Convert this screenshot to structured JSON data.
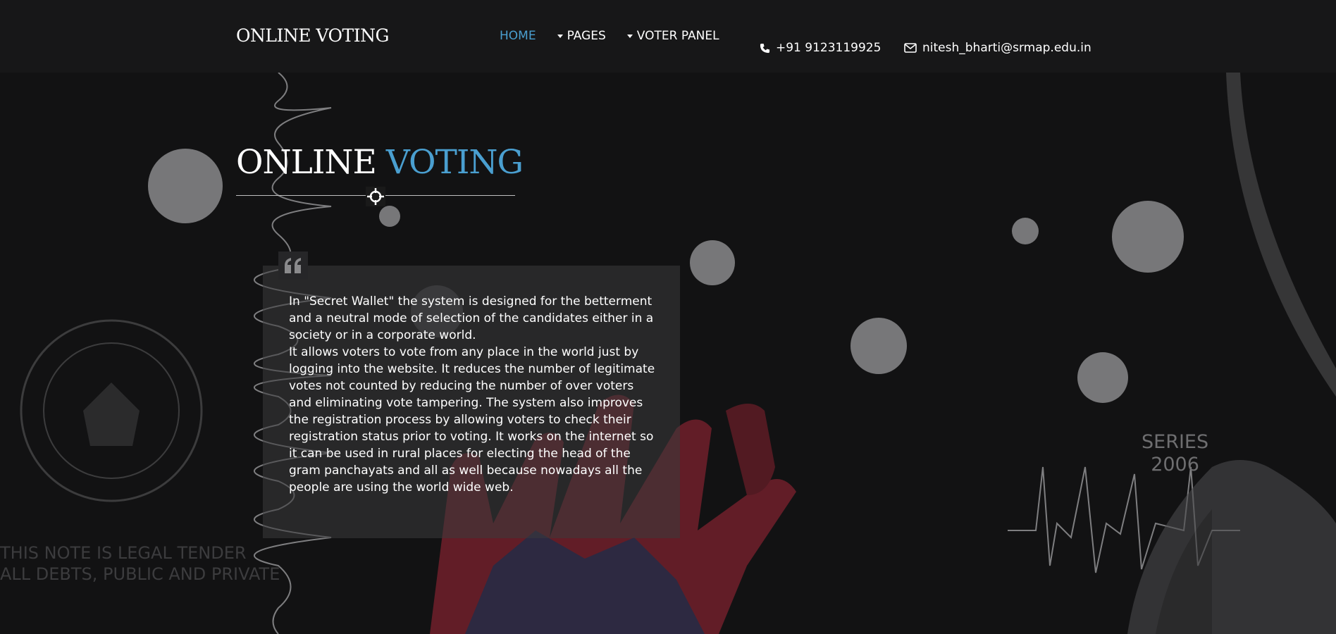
{
  "header": {
    "brand": "ONLINE VOTING",
    "nav": [
      {
        "label": "HOME",
        "active": true,
        "has_caret": false
      },
      {
        "label": "PAGES",
        "active": false,
        "has_caret": true
      },
      {
        "label": "VOTER PANEL",
        "active": false,
        "has_caret": true
      }
    ],
    "phone": "+91 9123119925",
    "email": "nitesh_bharti@srmap.edu.in"
  },
  "hero": {
    "title_main": "ONLINE",
    "title_accent": "VOTING"
  },
  "quote": {
    "paragraph1": "In \"Secret Wallet\" the system is designed for the betterment and a neutral mode of selection of the candidates either in a society or in a corporate world.",
    "paragraph2": "It allows voters to vote from any place in the world just by logging into the website. It reduces the number of legitimate votes not counted by reducing the number of over voters and eliminating vote tampering. The system also improves the registration process by allowing voters to check their registration status prior to voting. It works on the internet so it can be used in rural places for electing the head of the gram panchayats and all as well because nowadays all the people are using the world wide web."
  },
  "background": {
    "series_line1": "SERIES",
    "series_line2": "2006",
    "legal_line1": "THIS NOTE IS LEGAL TENDER",
    "legal_line2": "ALL DEBTS, PUBLIC AND PRIVATE"
  },
  "colors": {
    "accent": "#4a9fd0",
    "header_bg": "#171718",
    "page_bg": "#121213"
  }
}
